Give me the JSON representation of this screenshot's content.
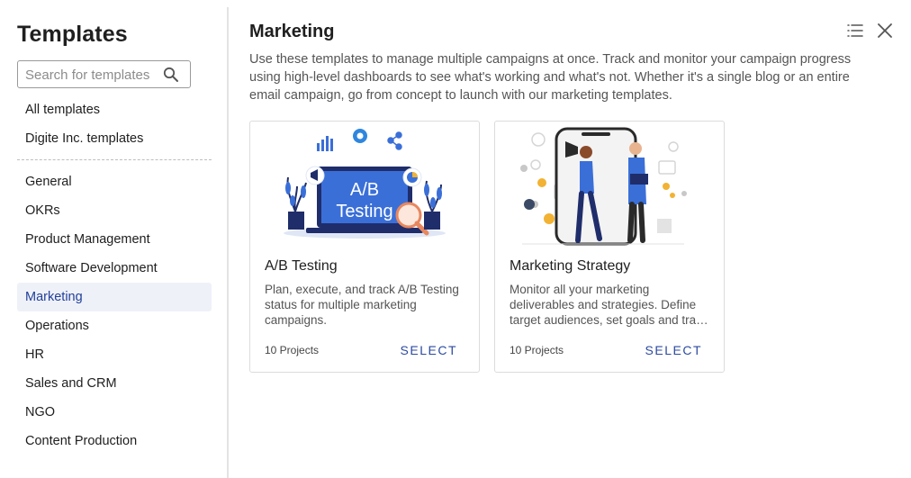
{
  "sidebar": {
    "title": "Templates",
    "search": {
      "placeholder": "Search for templates"
    },
    "items": [
      {
        "label": "All templates"
      },
      {
        "label": "Digite Inc. templates"
      },
      {
        "label": "General"
      },
      {
        "label": "OKRs"
      },
      {
        "label": "Product Management"
      },
      {
        "label": "Software Development"
      },
      {
        "label": "Marketing",
        "active": true
      },
      {
        "label": "Operations"
      },
      {
        "label": "HR"
      },
      {
        "label": "Sales and CRM"
      },
      {
        "label": "NGO"
      },
      {
        "label": "Content Production"
      }
    ]
  },
  "main": {
    "title": "Marketing",
    "description": "Use these templates to manage multiple campaigns at once. Track and monitor your campaign progress using high-level dashboards to see what's working and what's not. Whether it's a single blog or an entire email campaign, go from concept to launch with our marketing templates.",
    "cards": [
      {
        "title": "A/B Testing",
        "description": "Plan, execute, and track A/B Testing status for multiple marketing campaigns.",
        "count": "10 Projects",
        "select_label": "SELECT",
        "illustration_text": [
          "A/B",
          "Testing"
        ]
      },
      {
        "title": "Marketing Strategy",
        "description": "Monitor all your marketing deliverables and strategies. Define target audiences, set goals and track progress.",
        "count": "10 Projects",
        "select_label": "SELECT"
      }
    ]
  },
  "colors": {
    "accent": "#2d4aa0",
    "active_bg": "#eef1f8",
    "illustration_blue": "#3a6fd8"
  },
  "icons": [
    "search-icon",
    "list-view-icon",
    "close-icon"
  ]
}
